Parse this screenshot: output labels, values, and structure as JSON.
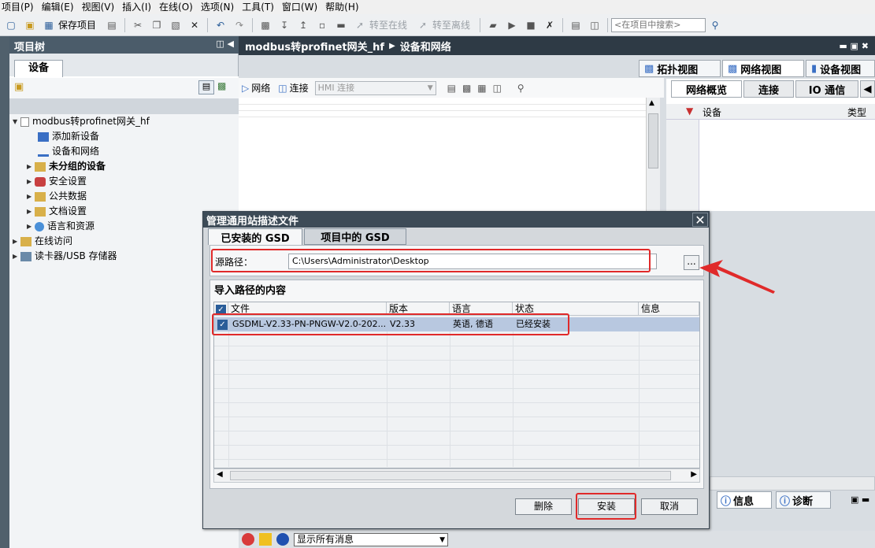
{
  "menu": [
    "项目(P)",
    "编辑(E)",
    "视图(V)",
    "插入(I)",
    "在线(O)",
    "选项(N)",
    "工具(T)",
    "窗口(W)",
    "帮助(H)"
  ],
  "toolbar": {
    "save_project": "保存项目",
    "go_online": "转至在线",
    "go_offline": "转至离线",
    "search_placeholder": "<在项目中搜索>"
  },
  "project_tree": {
    "title": "项目树",
    "tab": "设备",
    "items": [
      {
        "label": "modbus转profinet网关_hf",
        "level": 0,
        "expanded": true
      },
      {
        "label": "添加新设备",
        "level": 1
      },
      {
        "label": "设备和网络",
        "level": 1
      },
      {
        "label": "未分组的设备",
        "level": 1,
        "bold": true
      },
      {
        "label": "安全设置",
        "level": 1
      },
      {
        "label": "公共数据",
        "level": 1
      },
      {
        "label": "文档设置",
        "level": 1
      },
      {
        "label": "语言和资源",
        "level": 1
      },
      {
        "label": "在线访问",
        "level": 0
      },
      {
        "label": "读卡器/USB 存储器",
        "level": 0
      }
    ]
  },
  "editor": {
    "breadcrumb_project": "modbus转profinet网关_hf",
    "breadcrumb_page": "设备和网络",
    "view_tabs": [
      "拓扑视图",
      "网络视图",
      "设备视图"
    ],
    "network_toolbar": {
      "network": "网络",
      "connection": "连接",
      "connection_type": "HMI 连接"
    },
    "overview_tabs": [
      "网络概览",
      "连接",
      "IO 通信"
    ],
    "overview_columns": [
      "设备",
      "类型"
    ]
  },
  "dialog": {
    "title": "管理通用站描述文件",
    "tabs": [
      "已安装的 GSD",
      "项目中的 GSD"
    ],
    "source_path_label": "源路径：",
    "source_path_value": "C:\\Users\\Administrator\\Desktop",
    "browse_label": "...",
    "content_label": "导入路径的内容",
    "columns": [
      "文件",
      "版本",
      "语言",
      "状态",
      "信息"
    ],
    "rows": [
      {
        "checked": true,
        "file": "GSDML-V2.33-PN-PNGW-V2.0-202...",
        "version": "V2.33",
        "language": "英语, 德语",
        "status": "已经安装",
        "info": ""
      }
    ],
    "buttons": {
      "delete": "删除",
      "install": "安装",
      "cancel": "取消"
    }
  },
  "bottom": {
    "message_filter": "显示所有消息",
    "info_tabs": [
      "信息",
      "诊断"
    ]
  },
  "colors": {
    "highlight_red": "#e02a2a",
    "selection": "#b8c8e0",
    "title_bar": "#3d4b57"
  }
}
